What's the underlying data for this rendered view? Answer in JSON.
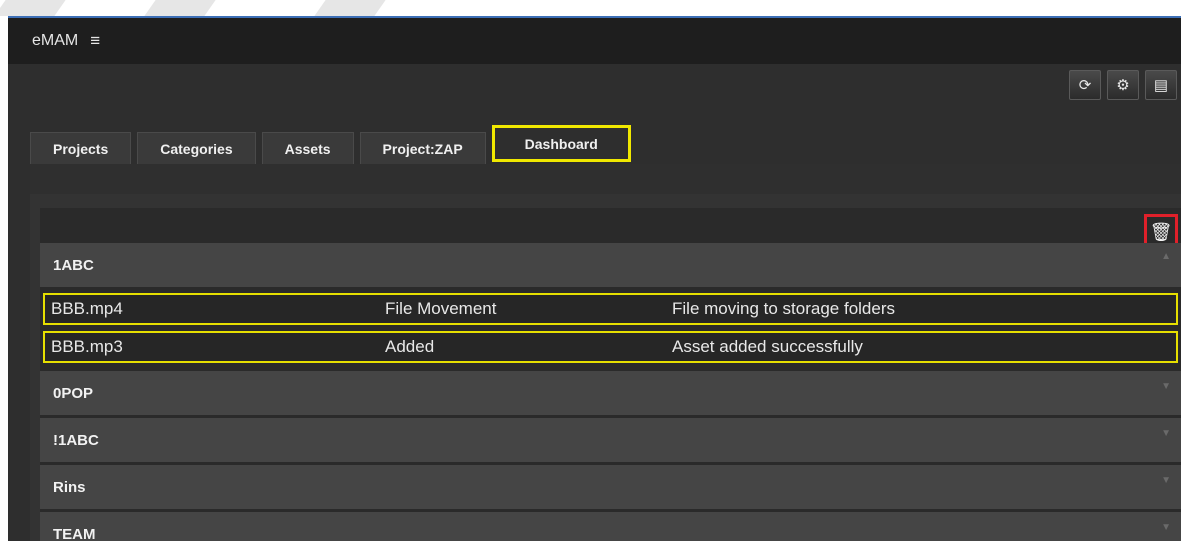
{
  "app": {
    "title": "eMAM",
    "menu_icon": "hamburger-menu-icon"
  },
  "toolbar": {
    "buttons": [
      {
        "icon": "refresh-icon",
        "glyph": "⟳"
      },
      {
        "icon": "gear-icon",
        "glyph": "⚙"
      },
      {
        "icon": "document-icon",
        "glyph": "▤"
      }
    ]
  },
  "tabs": [
    {
      "label": "Projects"
    },
    {
      "label": "Categories"
    },
    {
      "label": "Assets"
    },
    {
      "label": "Project:ZAP"
    },
    {
      "label": "Dashboard",
      "active": true
    }
  ],
  "dashboard": {
    "delete_icon": "trash-icon",
    "groups": [
      {
        "name": "1ABC",
        "expanded": true,
        "rows": [
          {
            "file": "BBB.mp4",
            "status": "File Movement",
            "message": "File moving to storage folders"
          },
          {
            "file": "BBB.mp3",
            "status": "Added",
            "message": "Asset added successfully"
          }
        ]
      },
      {
        "name": "0POP",
        "expanded": false
      },
      {
        "name": "!1ABC",
        "expanded": false
      },
      {
        "name": "Rins",
        "expanded": false
      },
      {
        "name": "TEAM",
        "expanded": false
      }
    ]
  },
  "colors": {
    "highlight_yellow": "#f0e800",
    "highlight_red": "#e0202a",
    "background": "#2e2e2e"
  }
}
